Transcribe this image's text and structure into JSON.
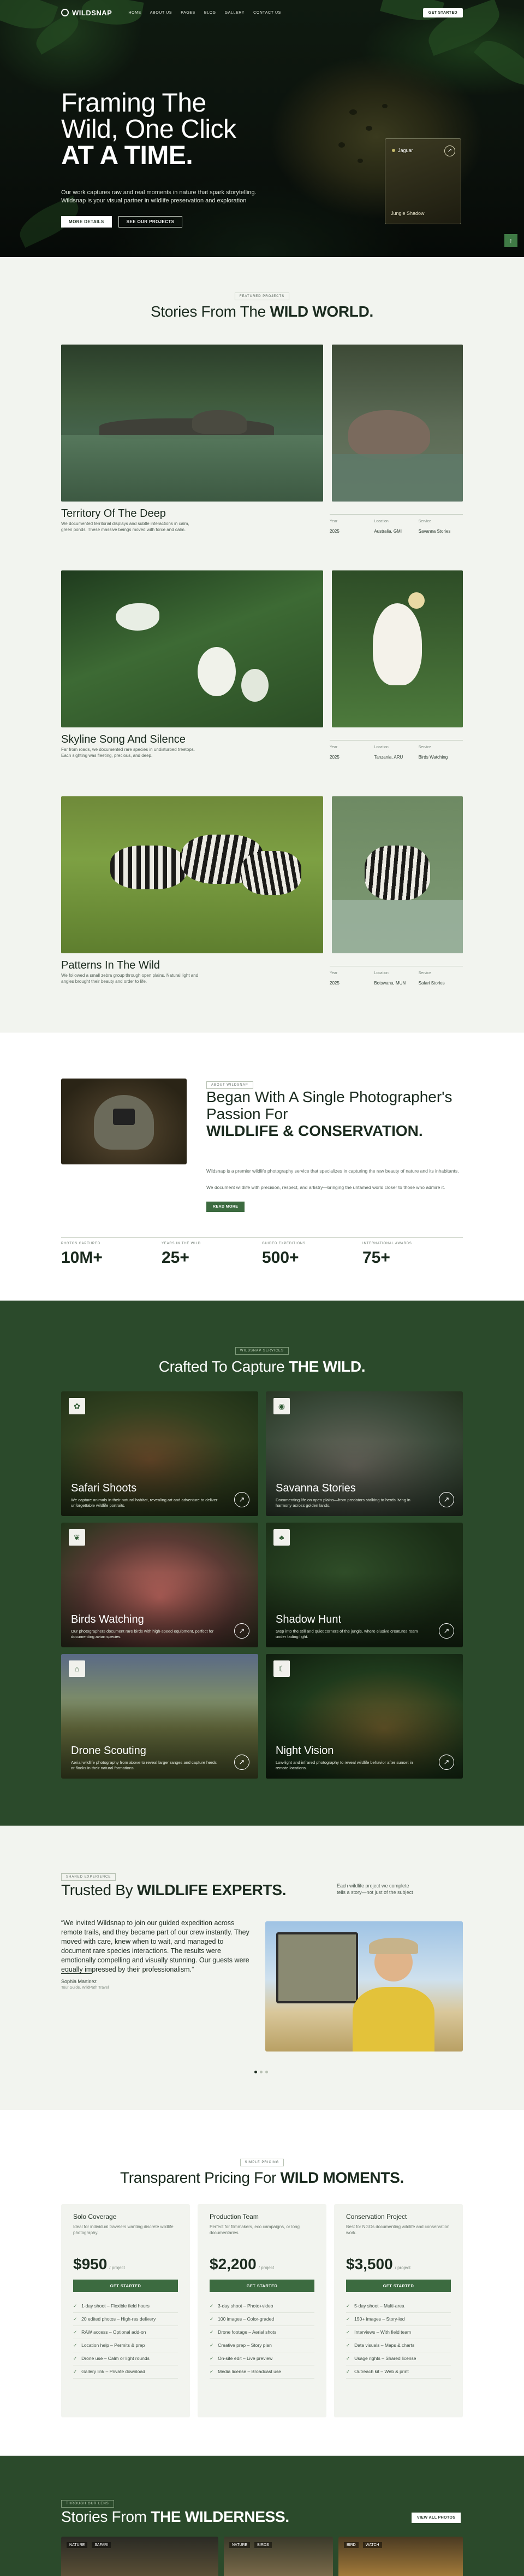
{
  "nav": {
    "logo": "WILDSNAP",
    "items": [
      "HOME",
      "ABOUT US",
      "PAGES",
      "BLOG",
      "GALLERY",
      "CONTACT US"
    ],
    "cta": "GET STARTED"
  },
  "hero": {
    "title_line1": "Framing The",
    "title_line2": "Wild, One Click",
    "title_bold": "AT A TIME.",
    "subtitle": "Our work captures raw and real moments in nature that spark storytelling. Wildsnap is your visual partner in wildlife preservation and exploration",
    "btn_primary": "MORE DETAILS",
    "btn_secondary": "SEE OUR PROJECTS",
    "card_title": "Jaguar",
    "card_caption": "Jungle Shadow"
  },
  "projects": {
    "tag": "FEATURED PROJECTS",
    "title_light": "Stories From The",
    "title_bold": "WILD WORLD.",
    "items": [
      {
        "title": "Territory Of The Deep",
        "desc": "We documented territorial displays and subtle interactions in calm, green ponds. These massive beings moved with force and calm.",
        "year_label": "Year",
        "year": "2025",
        "location_label": "Location",
        "location": "Australia, GMI",
        "service_label": "Service",
        "service": "Savanna Stories"
      },
      {
        "title": "Skyline Song And Silence",
        "desc": "Far from roads, we documented rare species in undisturbed treetops. Each sighting was fleeting, precious, and deep.",
        "year_label": "Year",
        "year": "2025",
        "location_label": "Location",
        "location": "Tanzania, ARU",
        "service_label": "Service",
        "service": "Birds Watching"
      },
      {
        "title": "Patterns In The Wild",
        "desc": "We followed a small zebra group through open plains. Natural light and angles brought their beauty and order to life.",
        "year_label": "Year",
        "year": "2025",
        "location_label": "Location",
        "location": "Botswana, MUN",
        "service_label": "Service",
        "service": "Safari Stories"
      }
    ]
  },
  "about": {
    "tag": "ABOUT WILDSNAP",
    "title_light": "Began With A Single Photographer's Passion For",
    "title_bold": "WILDLIFE & CONSERVATION.",
    "p1": "Wildsnap is a premier wildlife photography service that specializes in capturing the raw beauty of nature and its inhabitants.",
    "p2": "We document wildlife with precision, respect, and artistry—bringing the untamed world closer to those who admire it.",
    "btn": "READ MORE",
    "stats": [
      {
        "label": "PHOTOS CAPTURED",
        "value": "10M+"
      },
      {
        "label": "YEARS IN THE WILD",
        "value": "25+"
      },
      {
        "label": "GUIDED EXPEDITIONS",
        "value": "500+"
      },
      {
        "label": "INTERNATIONAL AWARDS",
        "value": "75+"
      }
    ]
  },
  "services": {
    "tag": "WILDSNAP SERVICES",
    "title_light": "Crafted To Capture",
    "title_bold": "THE WILD.",
    "items": [
      {
        "name": "Safari Shoots",
        "desc": "We capture animals in their natural habitat, revealing art and adventure to deliver unforgettable wildlife portraits."
      },
      {
        "name": "Savanna Stories",
        "desc": "Documenting life on open plains—from predators stalking to herds living in harmony across golden lands."
      },
      {
        "name": "Birds Watching",
        "desc": "Our photographers document rare birds with high-speed equipment, perfect for documenting avian species."
      },
      {
        "name": "Shadow Hunt",
        "desc": "Step into the still and quiet corners of the jungle, where elusive creatures roam under fading light."
      },
      {
        "name": "Drone Scouting",
        "desc": "Aerial wildlife photography from above to reveal larger ranges and capture herds or flocks in their natural formations."
      },
      {
        "name": "Night Vision",
        "desc": "Low-light and infrared photography to reveal wildlife behavior after sunset in remote locations."
      }
    ]
  },
  "testimonial": {
    "tag": "SHARED EXPERIENCE",
    "title_light": "Trusted By",
    "title_bold": "WILDLIFE EXPERTS.",
    "side": "Each wildlife project we complete tells a story—not just of the subject",
    "quote": "“We invited Wildsnap to join our guided expedition across remote trails, and they became part of our crew instantly. They moved with care, knew when to wait, and managed to document rare species interactions. The results were emotionally compelling and visually stunning. Our guests were equally impressed by their professionalism.”",
    "name": "Sophia Martinez",
    "role": "Tour Guide, WildPath Travel"
  },
  "pricing": {
    "tag": "SIMPLE PRICING",
    "title_light": "Transparent Pricing For",
    "title_bold": "WILD MOMENTS.",
    "plans": [
      {
        "name": "Solo Coverage",
        "desc": "Ideal for individual travelers wanting discrete wildlife photography.",
        "price": "$950",
        "unit": "/ project",
        "btn": "GET STARTED",
        "features": [
          "1-day shoot – Flexible field hours",
          "20 edited photos – High-res delivery",
          "RAW access – Optional add-on",
          "Location help – Permits & prep",
          "Drone use – Calm or light rounds",
          "Gallery link – Private download"
        ]
      },
      {
        "name": "Production Team",
        "desc": "Perfect for filmmakers, eco campaigns, or long documentaries.",
        "price": "$2,200",
        "unit": "/ project",
        "btn": "GET STARTED",
        "features": [
          "3-day shoot – Photo+video",
          "100 images – Color-graded",
          "Drone footage – Aerial shots",
          "Creative prep – Story plan",
          "On-site edit – Live preview",
          "Media license – Broadcast use"
        ]
      },
      {
        "name": "Conservation Project",
        "desc": "Best for NGOs documenting wildlife and conservation work.",
        "price": "$3,500",
        "unit": "/ project",
        "btn": "GET STARTED",
        "features": [
          "5-day shoot – Multi-area",
          "150+ images – Story-led",
          "Interviews – With field team",
          "Data visuals – Maps & charts",
          "Usage rights – Shared license",
          "Outreach kit – Web & print"
        ]
      }
    ]
  },
  "gallery": {
    "tag": "THROUGH OUR LENS",
    "title_light": "Stories From",
    "title_bold": "THE WILDERNESS.",
    "btn": "VIEW ALL PHOTOS",
    "thumbs": [
      {
        "a": "NATURE",
        "b": "SAFARI"
      },
      {
        "a": "NATURE",
        "b": "BIRDS"
      },
      {
        "a": "BIRD",
        "b": "WATCH"
      }
    ]
  }
}
